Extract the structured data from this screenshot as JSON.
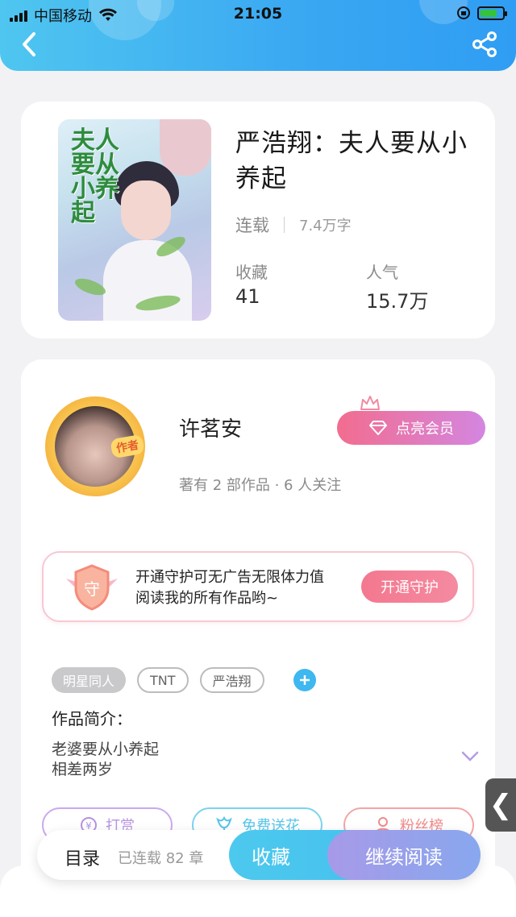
{
  "status_bar": {
    "carrier": "中国移动",
    "time": "21:05"
  },
  "header": {
    "back_icon": "chevron-left-icon",
    "share_icon": "share-icon"
  },
  "book": {
    "cover_title": "夫人要从小养起",
    "title": "严浩翔：夫人要从小养起",
    "status": "连载",
    "word_count": "7.4万字",
    "stats": [
      {
        "label": "收藏",
        "value": "41"
      },
      {
        "label": "人气",
        "value": "15.7万"
      }
    ]
  },
  "author": {
    "badge": "作者",
    "name": "许茗安",
    "subtitle": "著有 2 部作品 · 6 人关注",
    "vip_button": "点亮会员"
  },
  "guard": {
    "icon_char": "守",
    "line1": "开通守护可无广告无限体力值",
    "line2": "阅读我的所有作品哟~",
    "button": "开通守护"
  },
  "tags": [
    "明星同人",
    "TNT",
    "严浩翔"
  ],
  "intro": {
    "title": "作品简介：",
    "line1": "老婆要从小养起",
    "line2": "相差两岁"
  },
  "actions": [
    {
      "label": "打赏",
      "icon": "coin-icon",
      "color": "#b793e0"
    },
    {
      "label": "免费送花",
      "icon": "flower-icon",
      "color": "#55c5ea"
    },
    {
      "label": "粉丝榜",
      "icon": "fans-icon",
      "color": "#f08a8a"
    }
  ],
  "side_tab_glyph": "❮",
  "bottom_bar": {
    "toc_label": "目录",
    "toc_count": "已连载 82 章",
    "favorite_button": "收藏",
    "read_button": "继续阅读"
  },
  "colors": {
    "header_blue": "#3aa7f2",
    "vip_pink": "#f26d8f",
    "fav_blue": "#4dc9ee",
    "read_purple": "#a79ae8"
  }
}
